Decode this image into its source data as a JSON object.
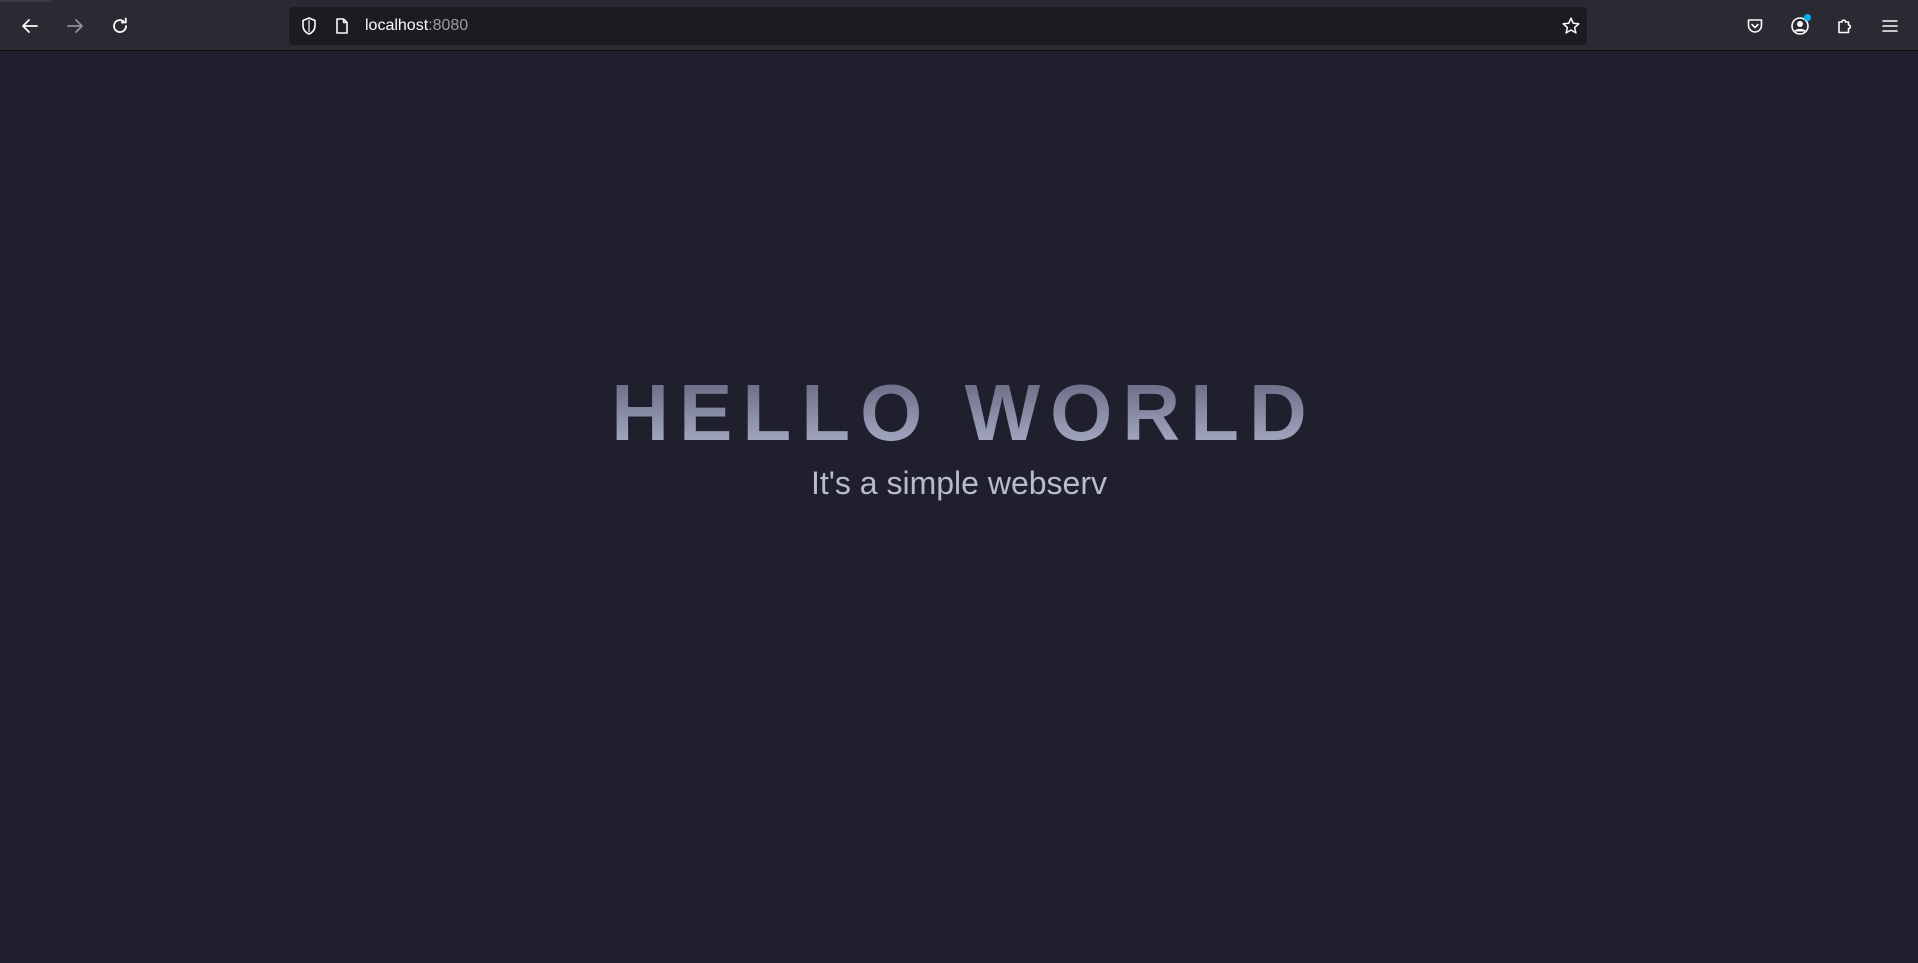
{
  "browser": {
    "url": {
      "host": "localhost",
      "port": ":8080"
    },
    "icons": {
      "back": "arrow-left-icon",
      "forward": "arrow-right-icon",
      "reload": "reload-icon",
      "tracking": "shield-icon",
      "page": "page-icon",
      "bookmark": "star-icon",
      "pocket": "pocket-icon",
      "account": "account-icon",
      "extensions": "puzzle-icon",
      "menu": "hamburger-menu-icon"
    },
    "colors": {
      "toolbar": "#2b2a33",
      "urlbar": "#1c1b22",
      "notification": "#00b3f4"
    }
  },
  "page": {
    "title": "HELLO WORLD",
    "subtitle": "It's a simple webserv",
    "colors": {
      "background": "#1f1f2e",
      "title_gradient_top": "#5c5e75",
      "title_gradient_bottom": "#b2b7cf",
      "subtitle": "#b9bbc8"
    }
  }
}
